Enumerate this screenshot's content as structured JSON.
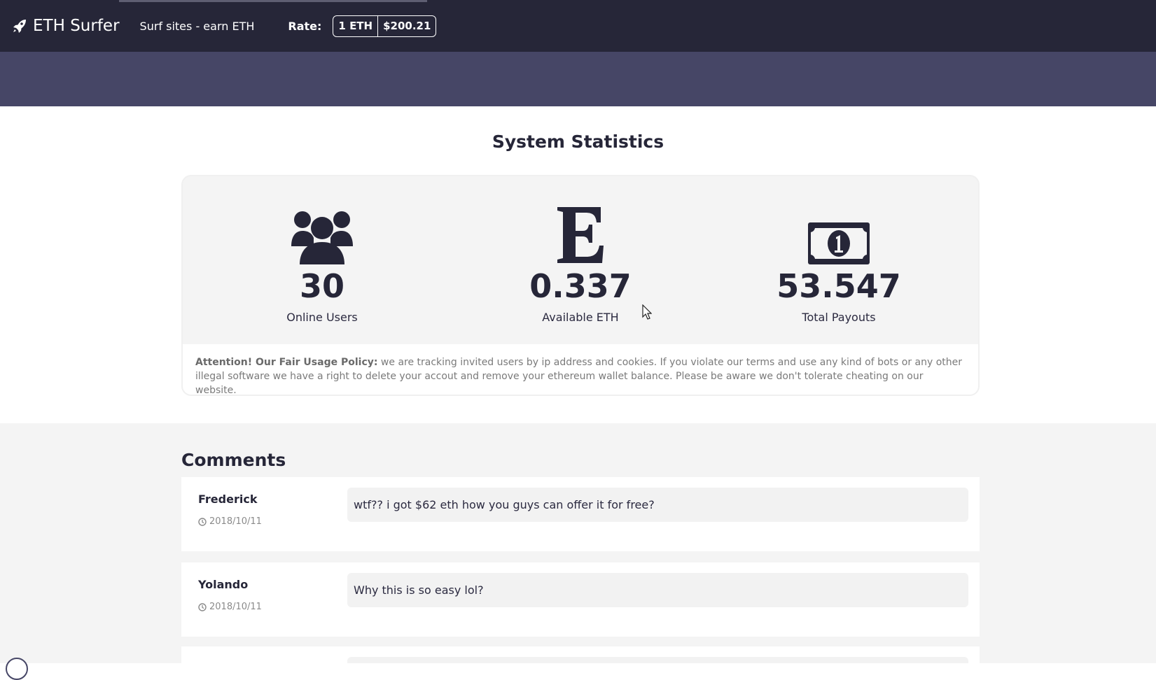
{
  "header": {
    "brand": "ETH Surfer",
    "tagline": "Surf sites - earn ETH",
    "rate_label": "Rate:",
    "rate_unit": "1 ETH",
    "rate_value": "$200.21"
  },
  "stats": {
    "title": "System Statistics",
    "items": [
      {
        "value": "30",
        "label": "Online Users",
        "icon": "users-icon"
      },
      {
        "value": "0.337",
        "label": "Available ETH",
        "icon": "ethereum-icon"
      },
      {
        "value": "53.547",
        "label": "Total Payouts",
        "icon": "money-bill-icon"
      }
    ],
    "notice_bold": "Attention! Our Fair Usage Policy:",
    "notice_text": " we are tracking invited users by ip address and cookies. If you violate our terms and use any kind of bots or any other illegal software we have a right to delete your accout and remove your ethereum wallet balance. Please be aware we don't tolerate cheating on our website."
  },
  "comments": {
    "title": "Comments",
    "items": [
      {
        "author": "Frederick",
        "date": "2018/10/11",
        "text": "wtf?? i got $62 eth how you guys can offer it for free?"
      },
      {
        "author": "Yolando",
        "date": "2018/10/11",
        "text": "Why this is so easy lol?"
      }
    ]
  },
  "colors": {
    "navbar": "#262638",
    "band": "#464666",
    "accent": "#262638"
  }
}
